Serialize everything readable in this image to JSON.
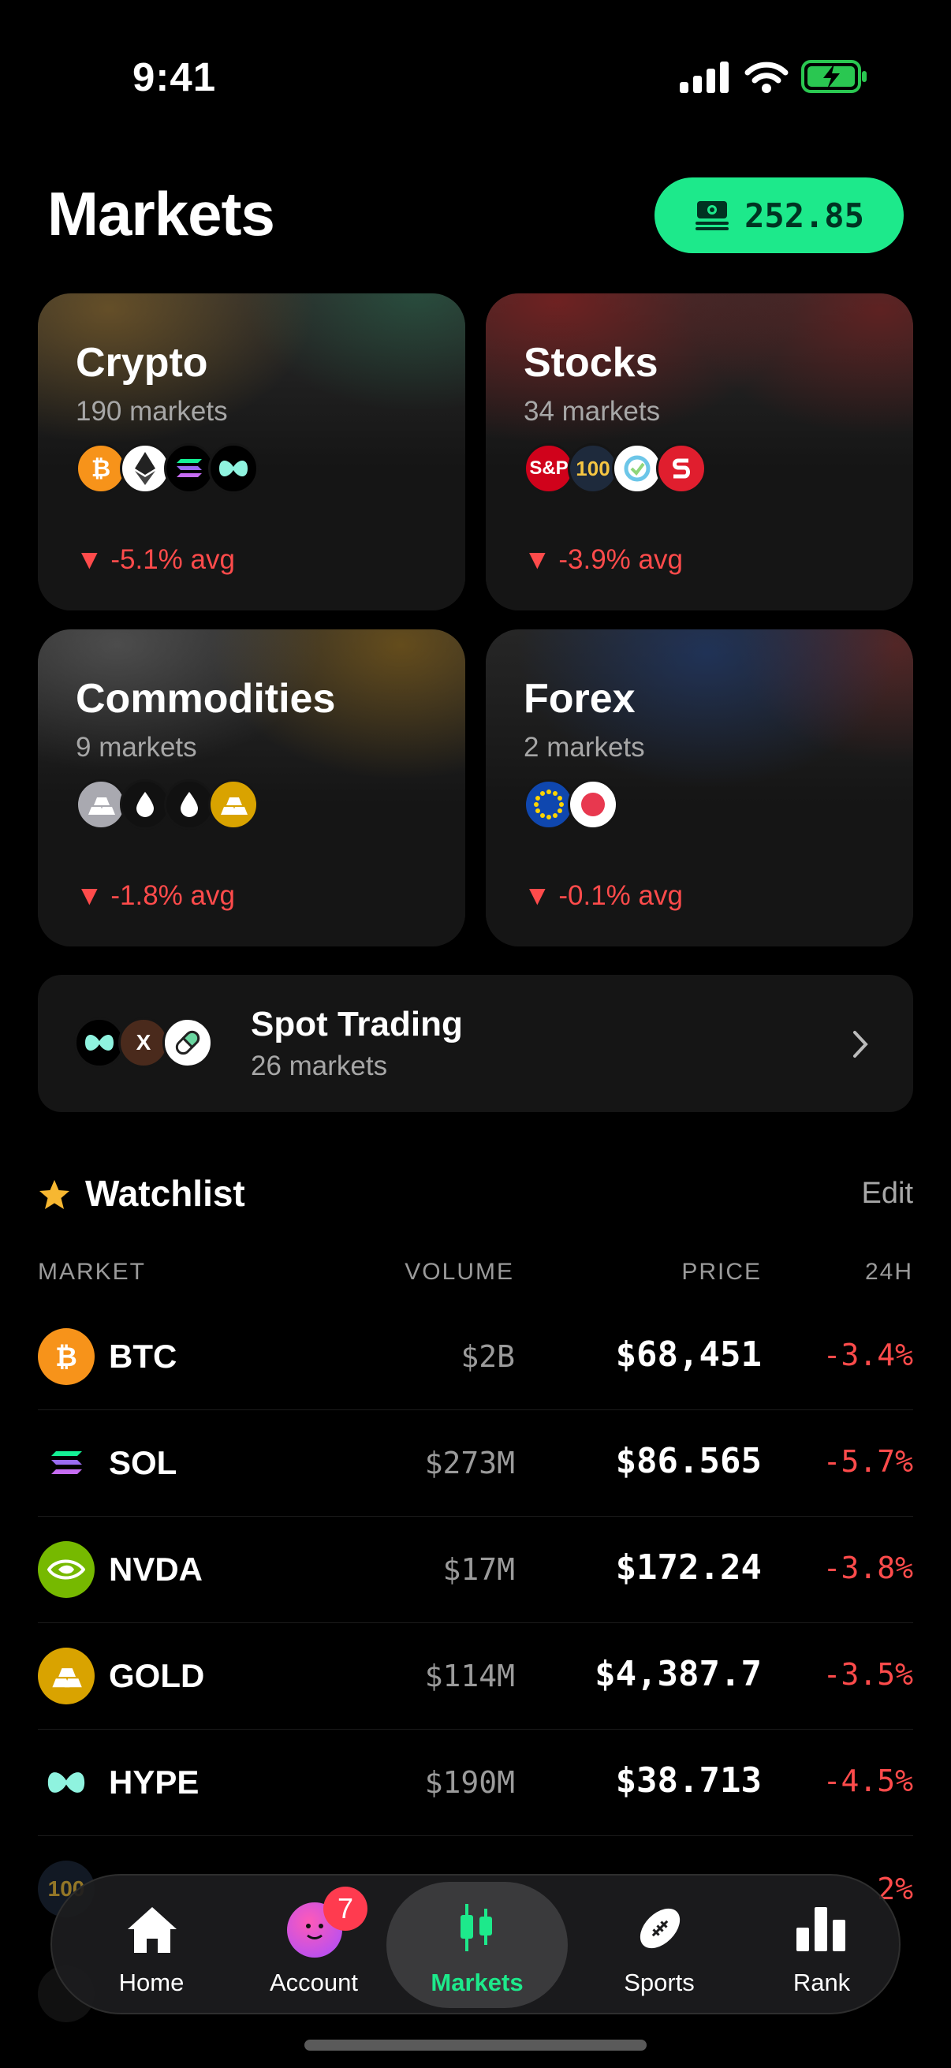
{
  "status_bar": {
    "time": "9:41"
  },
  "header": {
    "title": "Markets",
    "balance": "252.85"
  },
  "categories": [
    {
      "name": "Crypto",
      "markets": "190 markets",
      "avg": "-5.1% avg"
    },
    {
      "name": "Stocks",
      "markets": "34 markets",
      "avg": "-3.9% avg",
      "icons": [
        "S&P",
        "100"
      ]
    },
    {
      "name": "Commodities",
      "markets": "9 markets",
      "avg": "-1.8% avg"
    },
    {
      "name": "Forex",
      "markets": "2 markets",
      "avg": "-0.1% avg"
    }
  ],
  "spot": {
    "title": "Spot Trading",
    "markets": "26 markets",
    "icon_x": "X"
  },
  "watchlist": {
    "title": "Watchlist",
    "edit": "Edit",
    "columns": [
      "MARKET",
      "VOLUME",
      "PRICE",
      "24H"
    ],
    "rows": [
      {
        "symbol": "BTC",
        "volume": "$2B",
        "price": "$68,451",
        "change": "-3.4%"
      },
      {
        "symbol": "SOL",
        "volume": "$273M",
        "price": "$86.565",
        "change": "-5.7%"
      },
      {
        "symbol": "NVDA",
        "volume": "$17M",
        "price": "$172.24",
        "change": "-3.8%"
      },
      {
        "symbol": "GOLD",
        "volume": "$114M",
        "price": "$4,387.7",
        "change": "-3.5%"
      },
      {
        "symbol": "HYPE",
        "volume": "$190M",
        "price": "$38.713",
        "change": "-4.5%"
      }
    ],
    "partial_change": "2%",
    "partial_icon": "100"
  },
  "nav": {
    "items": [
      "Home",
      "Account",
      "Markets",
      "Sports",
      "Rank"
    ],
    "badge": "7",
    "active_color": "#1de98b"
  }
}
